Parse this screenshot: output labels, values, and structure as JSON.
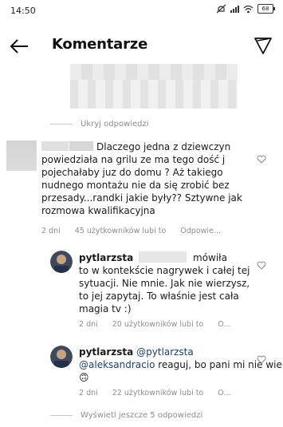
{
  "status": {
    "time": "14:50",
    "battery": "68"
  },
  "header": {
    "title": "Komentarze"
  },
  "hide_replies": "Ukryj odpowiedzi",
  "comment1": {
    "text_start": "Dlaczego jedna z dziewczyn",
    "text_rest": "powiedziała na grilu ze ma tego dość j pojechałaby juz do domu ? Aż takiego nudnego montażu nie da się zrobić bez przesady...randki jakie były?? Sztywne jak rozmowa kwalifikacyjna",
    "time": "2 dni",
    "likes": "45 użytkowników lubi to",
    "reply": "Odpowie..."
  },
  "reply1": {
    "username": "pytlarzsta",
    "mention_prefix": "@",
    "text_after_mention": "mówiła",
    "text_rest": "to w kontekście nagrywek i całej tej sytuacji. Nie mnie. Jak nie wierzysz, to jej zapytaj. To właśnie jest cała magia tv :)",
    "time": "2 dni",
    "likes": "20 użytkowników lubi to",
    "reply": "O..."
  },
  "reply2": {
    "username": "pytlarzsta",
    "mention1": "@pytlarzsta",
    "mention2": "@aleksandracio",
    "text": "reaguj, bo pani mi nie wierzy",
    "emoji": "🙃",
    "time": "2 dni",
    "likes": "22 użytkowników lubi to",
    "reply": "O..."
  },
  "view_more": "Wyświetl jeszcze 5 odpowiedzi"
}
